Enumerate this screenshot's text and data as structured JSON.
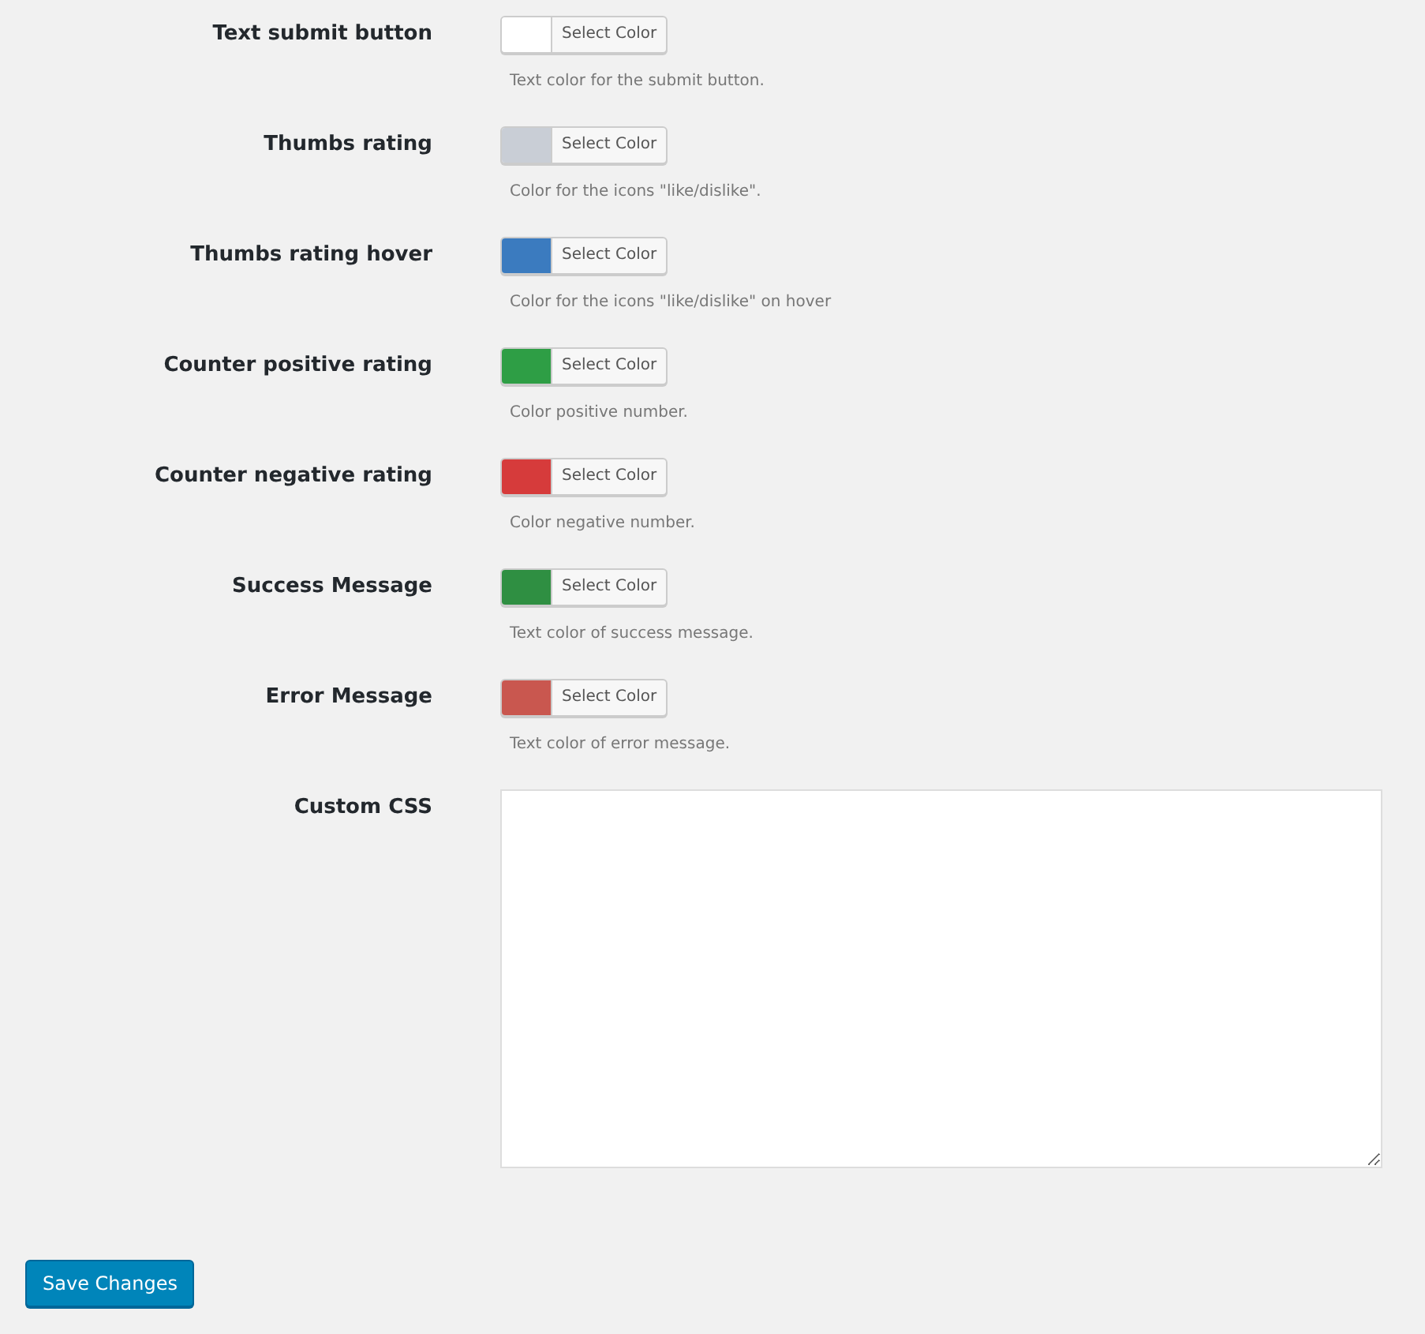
{
  "fields": [
    {
      "kind": "color",
      "label": "Text submit button",
      "color": "#ffffff",
      "button": "Select Color",
      "description": "Text color for the submit button."
    },
    {
      "kind": "color",
      "label": "Thumbs rating",
      "color": "#c9ced6",
      "button": "Select Color",
      "description": "Color for the icons \"like/dislike\"."
    },
    {
      "kind": "color",
      "label": "Thumbs rating hover",
      "color": "#3b7bbf",
      "button": "Select Color",
      "description": "Color for the icons \"like/dislike\" on hover"
    },
    {
      "kind": "color",
      "label": "Counter positive rating",
      "color": "#2e9e45",
      "button": "Select Color",
      "description": "Color positive number."
    },
    {
      "kind": "color",
      "label": "Counter negative rating",
      "color": "#d63b3b",
      "button": "Select Color",
      "description": "Color negative number."
    },
    {
      "kind": "color",
      "label": "Success Message",
      "color": "#2f8f42",
      "button": "Select Color",
      "description": "Text color of success message."
    },
    {
      "kind": "color",
      "label": "Error Message",
      "color": "#c9574f",
      "button": "Select Color",
      "description": "Text color of error message."
    },
    {
      "kind": "textarea",
      "label": "Custom CSS"
    }
  ],
  "submit": {
    "label": "Save Changes"
  }
}
